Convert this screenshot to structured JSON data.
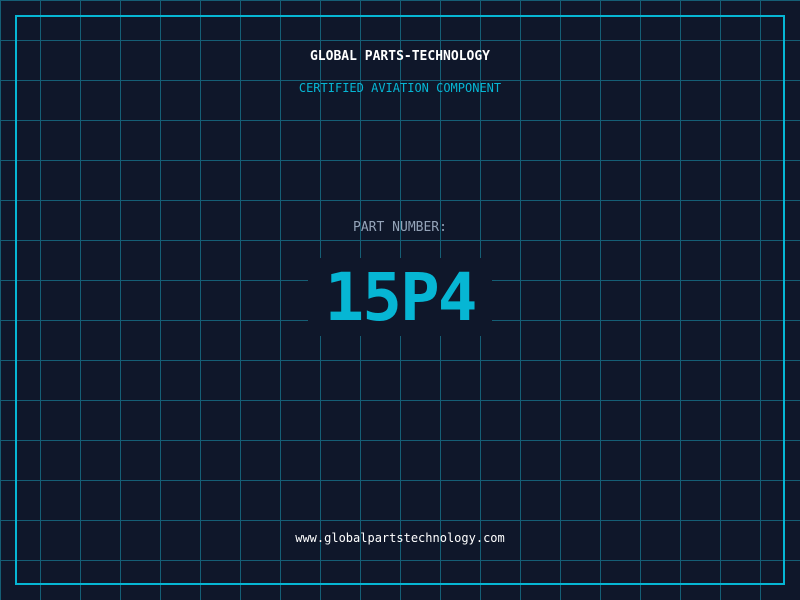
{
  "header": {
    "title": "GLOBAL PARTS-TECHNOLOGY",
    "subtitle": "CERTIFIED AVIATION COMPONENT"
  },
  "part": {
    "label": "PART NUMBER:",
    "number": "15P4"
  },
  "footer": {
    "url": "www.globalpartstechnology.com"
  },
  "colors": {
    "background": "#0f172a",
    "grid": "#155e75",
    "accent": "#06b6d4",
    "label": "#94a3b8"
  }
}
